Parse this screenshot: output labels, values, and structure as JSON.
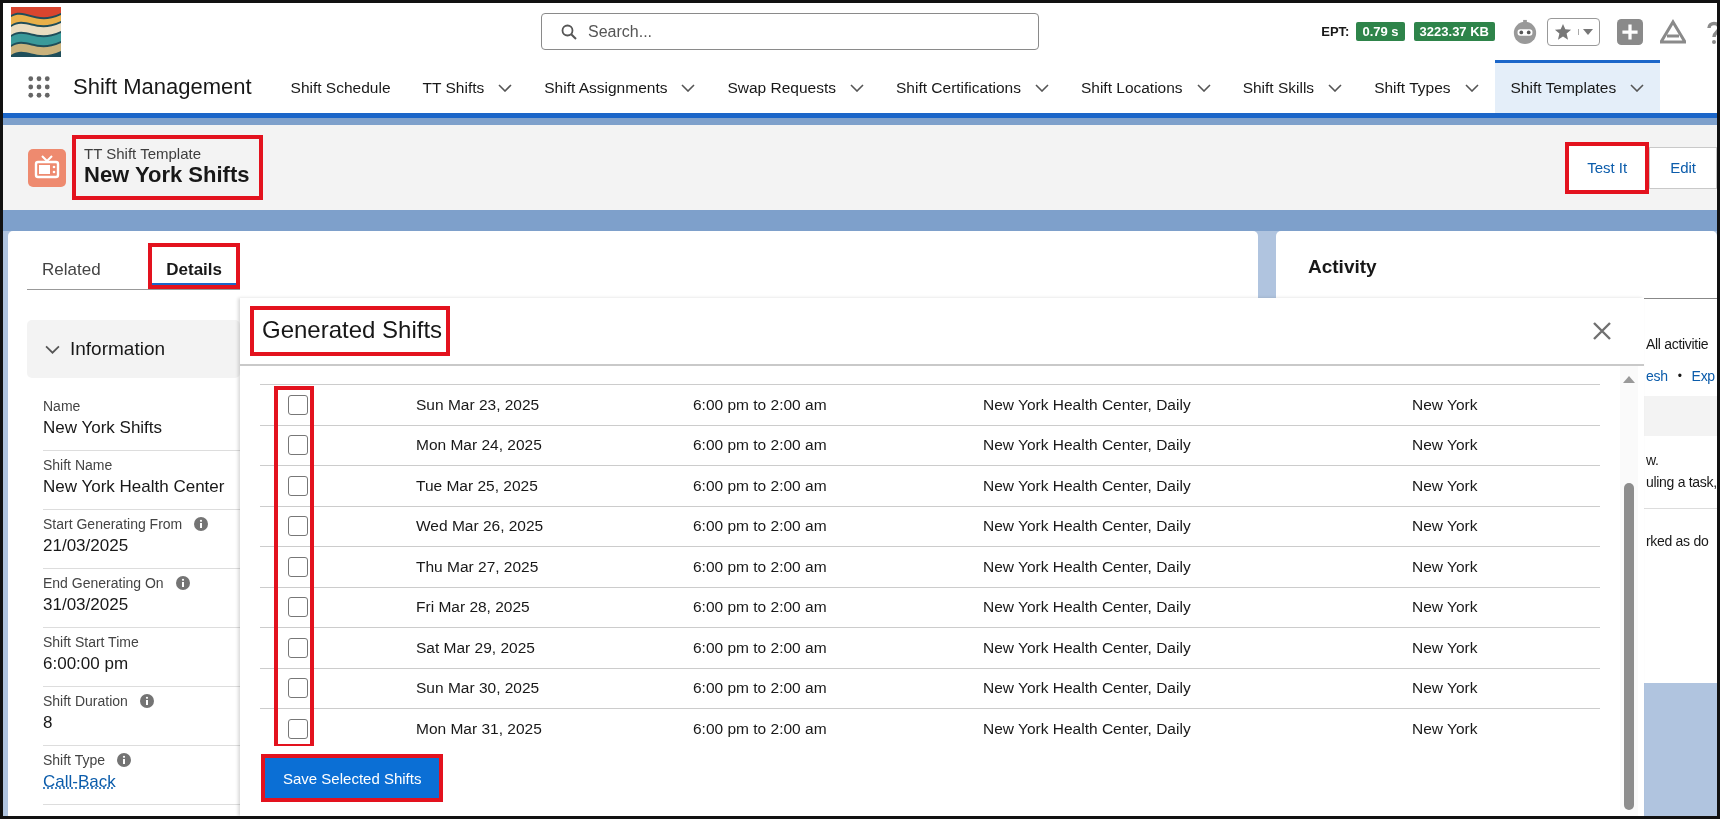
{
  "header": {
    "search": {
      "placeholder": "Search..."
    },
    "ept_label": "EPT:",
    "ept_time": "0.79 s",
    "ept_memory": "3223.37 KB"
  },
  "app": {
    "name": "Shift Management"
  },
  "nav_tabs": [
    {
      "label": "Shift Schedule",
      "has_menu": false,
      "selected": false
    },
    {
      "label": "TT Shifts",
      "has_menu": true,
      "selected": false
    },
    {
      "label": "Shift Assignments",
      "has_menu": true,
      "selected": false
    },
    {
      "label": "Swap Requests",
      "has_menu": true,
      "selected": false
    },
    {
      "label": "Shift Certifications",
      "has_menu": true,
      "selected": false
    },
    {
      "label": "Shift Locations",
      "has_menu": true,
      "selected": false
    },
    {
      "label": "Shift Skills",
      "has_menu": true,
      "selected": false
    },
    {
      "label": "Shift Types",
      "has_menu": true,
      "selected": false
    },
    {
      "label": "Shift Templates",
      "has_menu": true,
      "selected": true
    }
  ],
  "record": {
    "object_type": "TT Shift Template",
    "title": "New York Shifts",
    "highlighted": true,
    "actions": [
      {
        "label": "Test It",
        "highlighted": true
      },
      {
        "label": "Edit",
        "highlighted": false
      }
    ]
  },
  "detail_tabs": [
    {
      "label": "Related",
      "selected": false,
      "highlighted": false
    },
    {
      "label": "Details",
      "selected": true,
      "highlighted": true
    }
  ],
  "section": {
    "title": "Information",
    "expanded": true
  },
  "fields": [
    {
      "label": "Name",
      "value": "New York Shifts",
      "has_info": false,
      "kind": "text"
    },
    {
      "label": "Shift Name",
      "value": "New York Health Center",
      "has_info": false,
      "kind": "text"
    },
    {
      "label": "Start Generating From",
      "value": "21/03/2025",
      "has_info": true,
      "kind": "text"
    },
    {
      "label": "End Generating On",
      "value": "31/03/2025",
      "has_info": true,
      "kind": "text"
    },
    {
      "label": "Shift Start Time",
      "value": "6:00:00 pm",
      "has_info": false,
      "kind": "text"
    },
    {
      "label": "Shift Duration",
      "value": "8",
      "has_info": true,
      "kind": "text"
    },
    {
      "label": "Shift Type",
      "value": "Call-Back",
      "has_info": true,
      "kind": "link"
    }
  ],
  "activity": {
    "title": "Activity",
    "filter_text": "All activitie",
    "links": [
      "esh",
      "Exp"
    ],
    "separator": "•",
    "lines": [
      "w.",
      "uling a task,"
    ],
    "done_text": "rked as do"
  },
  "modal": {
    "title": "Generated Shifts",
    "title_highlighted": true,
    "checkbox_column_highlighted": true,
    "rows": [
      {
        "date": "Sun Mar 23, 2025",
        "time": "6:00 pm to 2:00 am",
        "location": "New York Health Center, Daily",
        "city": "New York",
        "checked": false
      },
      {
        "date": "Mon Mar 24, 2025",
        "time": "6:00 pm to 2:00 am",
        "location": "New York Health Center, Daily",
        "city": "New York",
        "checked": false
      },
      {
        "date": "Tue Mar 25, 2025",
        "time": "6:00 pm to 2:00 am",
        "location": "New York Health Center, Daily",
        "city": "New York",
        "checked": false
      },
      {
        "date": "Wed Mar 26, 2025",
        "time": "6:00 pm to 2:00 am",
        "location": "New York Health Center, Daily",
        "city": "New York",
        "checked": false
      },
      {
        "date": "Thu Mar 27, 2025",
        "time": "6:00 pm to 2:00 am",
        "location": "New York Health Center, Daily",
        "city": "New York",
        "checked": false
      },
      {
        "date": "Fri Mar 28, 2025",
        "time": "6:00 pm to 2:00 am",
        "location": "New York Health Center, Daily",
        "city": "New York",
        "checked": false
      },
      {
        "date": "Sat Mar 29, 2025",
        "time": "6:00 pm to 2:00 am",
        "location": "New York Health Center, Daily",
        "city": "New York",
        "checked": false
      },
      {
        "date": "Sun Mar 30, 2025",
        "time": "6:00 pm to 2:00 am",
        "location": "New York Health Center, Daily",
        "city": "New York",
        "checked": false
      },
      {
        "date": "Mon Mar 31, 2025",
        "time": "6:00 pm to 2:00 am",
        "location": "New York Health Center, Daily",
        "city": "New York",
        "checked": false
      }
    ],
    "save_button": {
      "label": "Save Selected Shifts",
      "highlighted": true
    }
  }
}
